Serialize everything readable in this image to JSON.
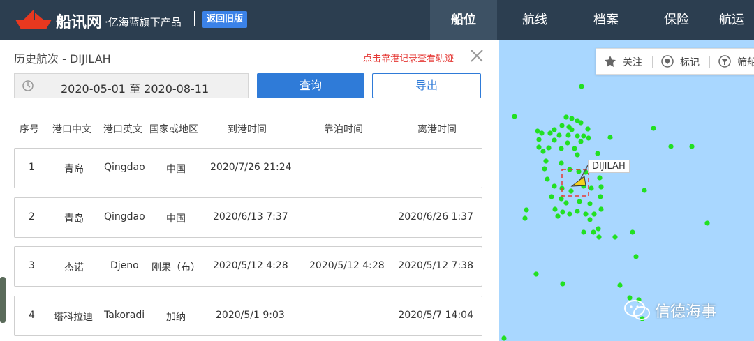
{
  "header": {
    "brand": "船讯网",
    "brand_sub": "·亿海蓝旗下产品",
    "old_version_button": "返回旧版",
    "nav": [
      "船位",
      "航线",
      "档案",
      "保险",
      "航运"
    ]
  },
  "panel": {
    "title": "历史航次 - DIJILAH",
    "hint": "点击靠港记录查看轨迹",
    "date_range": "2020-05-01 至 2020-08-11",
    "query_button": "查询",
    "export_button": "导出",
    "columns": [
      "序号",
      "港口中文",
      "港口英文",
      "国家或地区",
      "到港时间",
      "靠泊时间",
      "离港时间"
    ],
    "rows": [
      {
        "no": "1",
        "cn": "青岛",
        "en": "Qingdao",
        "country": "中国",
        "arrive": "2020/7/26 21:24",
        "berth": "",
        "depart": ""
      },
      {
        "no": "2",
        "cn": "青岛",
        "en": "Qingdao",
        "country": "中国",
        "arrive": "2020/6/13 7:37",
        "berth": "",
        "depart": "2020/6/26 1:37"
      },
      {
        "no": "3",
        "cn": "杰诺",
        "en": "Djeno",
        "country": "刚果（布）",
        "arrive": "2020/5/12 4:28",
        "berth": "2020/5/12 4:28",
        "depart": "2020/5/12 7:38"
      },
      {
        "no": "4",
        "cn": "塔科拉迪",
        "en": "Takoradi",
        "country": "加纳",
        "arrive": "2020/5/1 9:03",
        "berth": "",
        "depart": "2020/5/7 14:04"
      }
    ]
  },
  "map": {
    "toolbar": [
      "关注",
      "标记",
      "筛船"
    ],
    "ship_label": "DIJILAH",
    "watermark": "信德海事",
    "colors": {
      "sea": "#a9d7ff",
      "ship_dot": "#22e022",
      "ship_marker": "#f5d21e",
      "highlight": "#e53935"
    }
  }
}
